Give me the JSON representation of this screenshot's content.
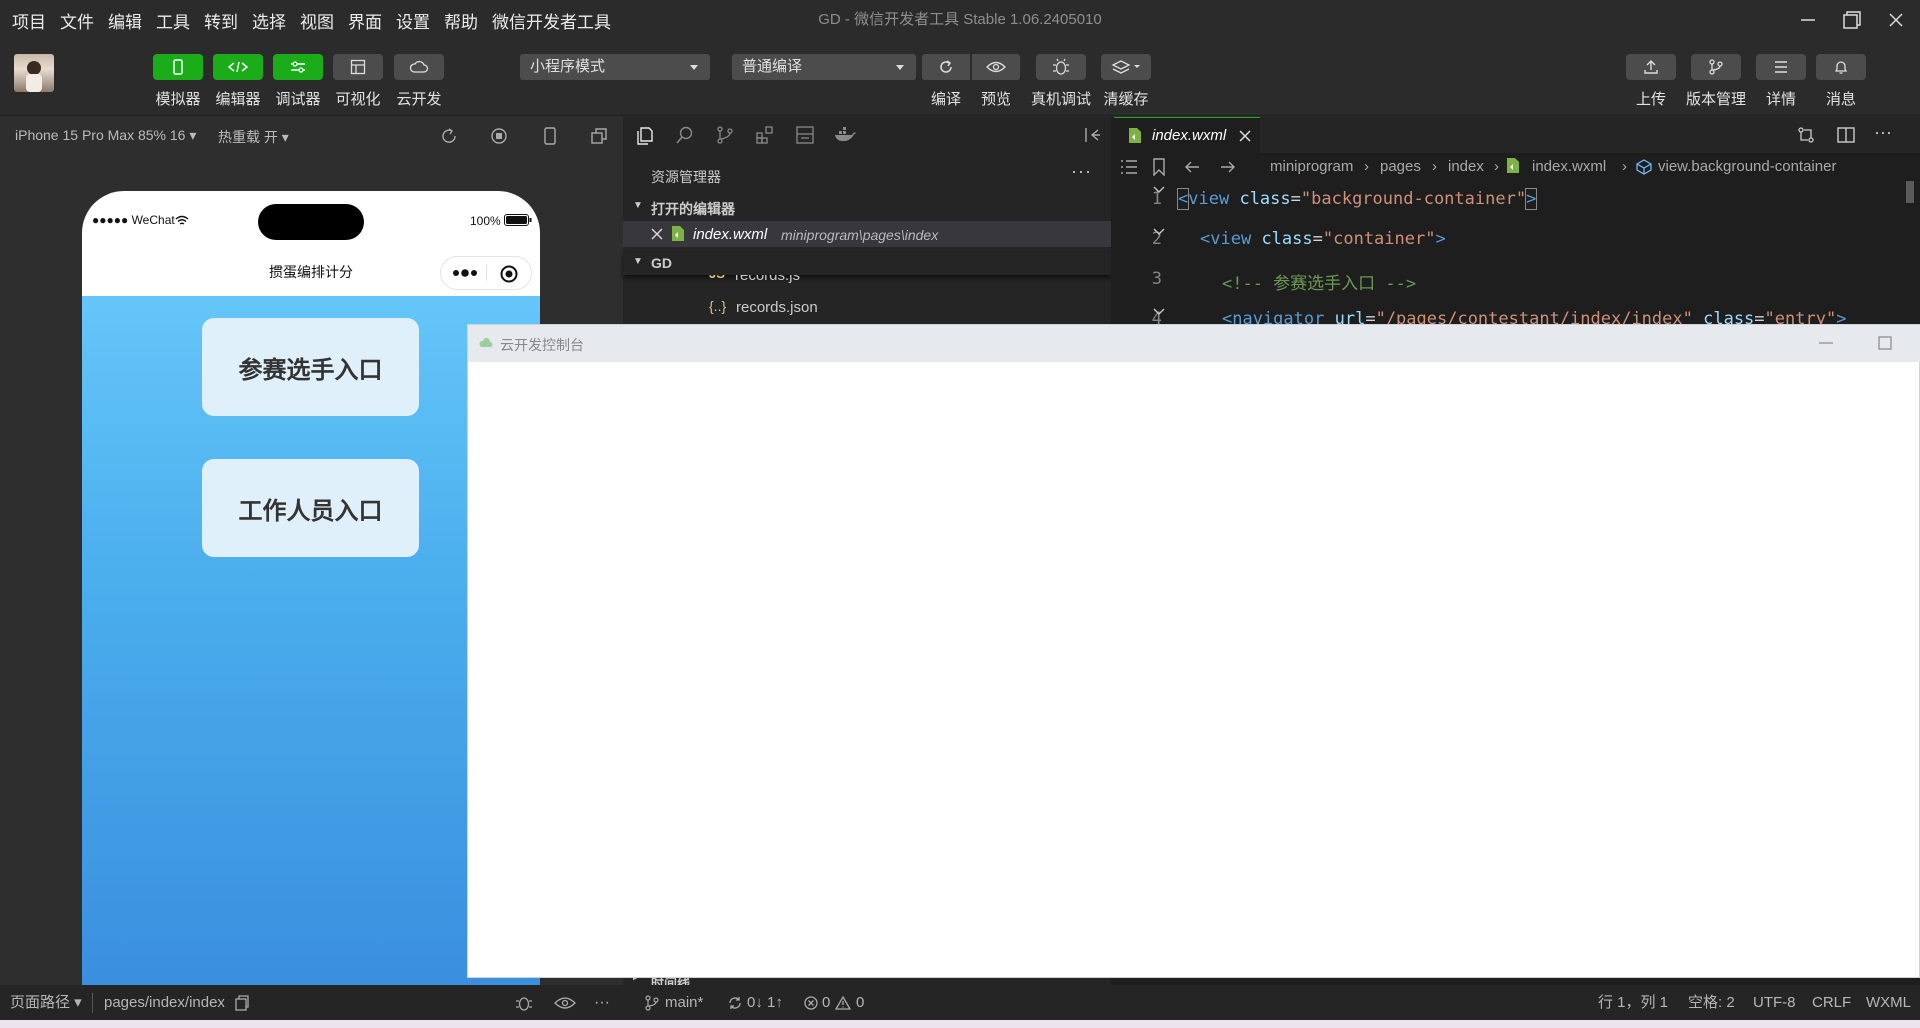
{
  "window": {
    "title": "GD - 微信开发者工具 Stable 1.06.2405010"
  },
  "menu": [
    "项目",
    "文件",
    "编辑",
    "工具",
    "转到",
    "选择",
    "视图",
    "界面",
    "设置",
    "帮助",
    "微信开发者工具"
  ],
  "toolbar": {
    "mode_buttons": [
      "模拟器",
      "编辑器",
      "调试器",
      "可视化",
      "云开发"
    ],
    "mode_select": "小程序模式",
    "compile_select": "普通编译",
    "actions": [
      "编译",
      "预览",
      "真机调试",
      "清缓存"
    ],
    "right_actions": [
      "上传",
      "版本管理",
      "详情",
      "消息"
    ]
  },
  "simulator": {
    "device": "iPhone 15 Pro Max 85% 16",
    "hot_reload": "热重载 开",
    "status_carrier": "●●●●● WeChat",
    "battery": "100%",
    "page_title": "掼蛋编排计分",
    "buttons": [
      "参赛选手入口",
      "工作人员入口"
    ]
  },
  "explorer": {
    "title": "资源管理器",
    "open_editors_label": "打开的编辑器",
    "open_file": "index.wxml",
    "open_file_path": "miniprogram\\pages\\index",
    "project_label": "GD",
    "files": [
      "records.js",
      "records.json"
    ],
    "outline_label": "时间线"
  },
  "editor": {
    "tab": "index.wxml",
    "breadcrumb": [
      "miniprogram",
      "pages",
      "index",
      "index.wxml",
      "view.background-container"
    ],
    "line_numbers": [
      "1",
      "2",
      "3",
      "4"
    ]
  },
  "console": {
    "title": "云开发控制台"
  },
  "statusbar": {
    "page_path_label": "页面路径",
    "page_path": "pages/index/index",
    "branch": "main*",
    "sync": "0↓ 1↑",
    "errors": "0",
    "warnings": "0",
    "cursor": "行 1，列 1",
    "spaces": "空格: 2",
    "encoding": "UTF-8",
    "eol": "CRLF",
    "language": "WXML"
  },
  "colors": {
    "accent": "#1aad19",
    "editor_bg": "#1e1e1e",
    "sidebar_bg": "#252526",
    "gradient_top": "#64c6f8",
    "gradient_bottom": "#3a8fde"
  }
}
